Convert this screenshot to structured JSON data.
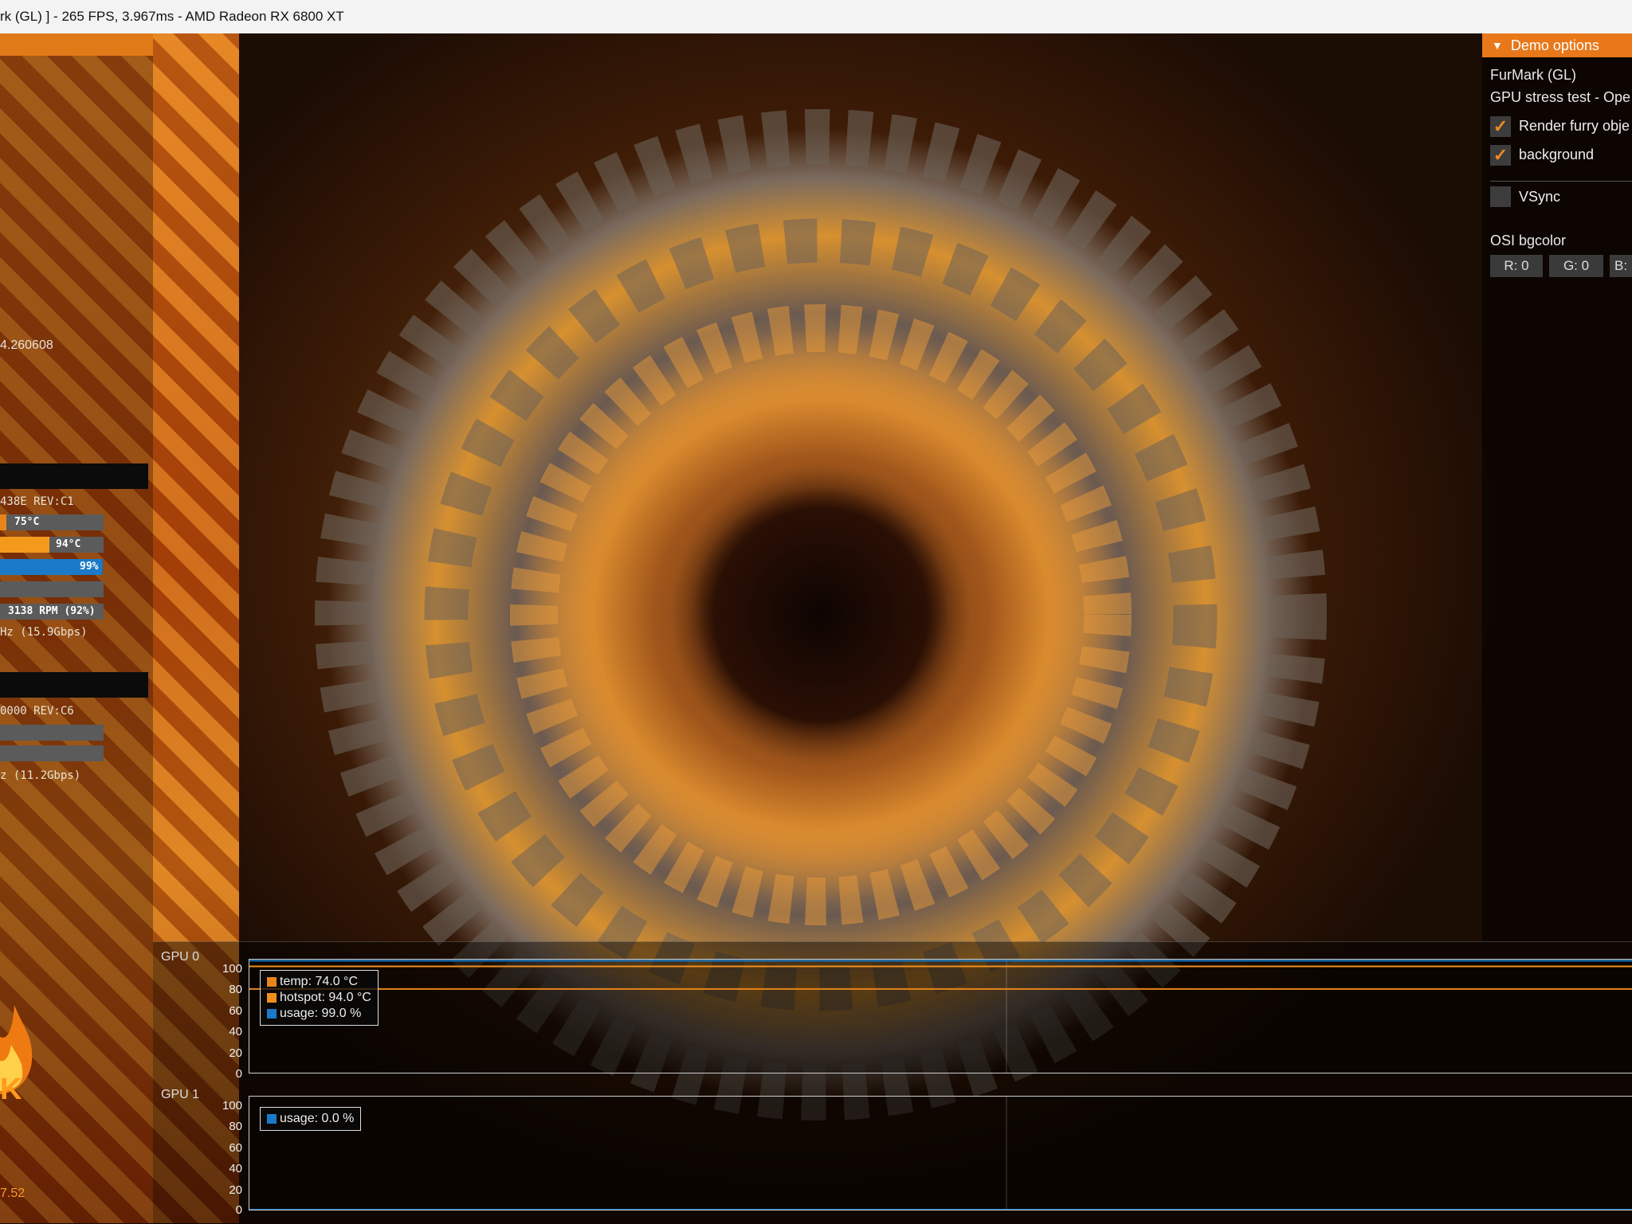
{
  "window": {
    "title": "rk (GL) ] - 265 FPS, 3.967ms - AMD Radeon RX 6800 XT"
  },
  "left_panel": {
    "value_text": "4.260608",
    "gpu0_id": "438E REV:C1",
    "gpu0_temp": "75°C",
    "gpu0_hotspot": "94°C",
    "gpu0_usage": "99%",
    "gpu0_fan": "3138 RPM (92%)",
    "gpu0_mem": "Hz (15.9Gbps)",
    "gpu1_id": "0000 REV:C6",
    "gpu1_mem": "z (11.2Gbps)",
    "version": "7.52",
    "gauges": {
      "gpu0_temp_fill": 0.06,
      "gpu0_hotspot_fill": 0.47,
      "gpu0_usage_fill": 0.99
    }
  },
  "demo_options": {
    "header": "Demo options",
    "app_name": "FurMark (GL)",
    "subtitle": "GPU stress test - Ope",
    "render_furry": "Render furry obje",
    "background": "background",
    "vsync": "VSync",
    "osi_bgcolor": "OSI bgcolor",
    "r": "R: 0",
    "g": "G: 0",
    "b": "B:"
  },
  "graphs": {
    "gpu0": {
      "label": "GPU 0",
      "y_ticks": [
        "100",
        "80",
        "60",
        "40",
        "20",
        "0"
      ],
      "legend": [
        {
          "text": "temp: 74.0 °C",
          "color": "#e8841a"
        },
        {
          "text": "hotspot: 94.0 °C",
          "color": "#f0901c"
        },
        {
          "text": "usage: 99.0 %",
          "color": "#1a7ac8"
        }
      ],
      "series_values": {
        "temp": 74.0,
        "hotspot": 94.0,
        "usage": 99.0
      }
    },
    "gpu1": {
      "label": "GPU 1",
      "y_ticks": [
        "100",
        "80",
        "60",
        "40",
        "20",
        "0"
      ],
      "legend": [
        {
          "text": "usage: 0.0 %",
          "color": "#1a7ac8"
        }
      ],
      "series_values": {
        "usage": 0.0
      }
    }
  },
  "colors": {
    "accent": "#e8781a",
    "usage_blue": "#1a7ac8",
    "temp_orange": "#e8841a"
  }
}
